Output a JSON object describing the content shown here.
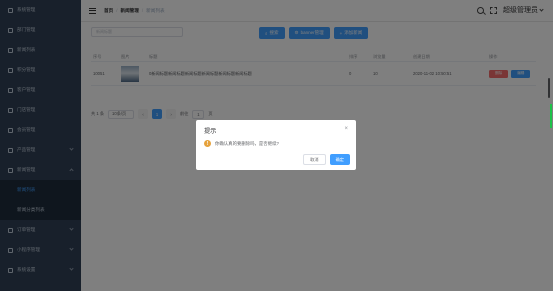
{
  "sidebar": {
    "items": [
      {
        "label": "系统管理",
        "chevron": false
      },
      {
        "label": "部门管理",
        "chevron": false
      },
      {
        "label": "新闻列表",
        "chevron": false
      },
      {
        "label": "积分管理",
        "chevron": false
      },
      {
        "label": "客户管理",
        "chevron": false
      },
      {
        "label": "门店管理",
        "chevron": false
      },
      {
        "label": "会员管理",
        "chevron": false
      },
      {
        "label": "产品管理",
        "chevron": true
      },
      {
        "label": "新闻管理",
        "chevron": true
      }
    ],
    "sub_items": [
      "新闻列表",
      "新闻分类列表"
    ],
    "bottom_items": [
      {
        "label": "订单管理",
        "chevron": true
      },
      {
        "label": "小程序管理",
        "chevron": true
      },
      {
        "label": "系统设置",
        "chevron": true
      }
    ]
  },
  "header": {
    "breadcrumb": [
      "首页",
      "新闻管理",
      "新闻列表"
    ],
    "user": "超级管理员"
  },
  "toolbar": {
    "search_placeholder": "新闻标题",
    "search_label": "搜索",
    "banner_label": "banner管理",
    "add_label": "添加新闻"
  },
  "table": {
    "headers": {
      "id": "序号",
      "img": "图片",
      "title": "标题",
      "sort": "排序",
      "views": "浏览量",
      "date": "创建日期",
      "actions": "操作"
    },
    "rows": [
      {
        "id": "10051",
        "title": "0新闻标题新闻标题新闻标题新闻标题新闻标题新闻标题",
        "sort": "0",
        "views": "10",
        "date": "2020-11-02 10:50:51",
        "delete": "删除",
        "edit": "编辑"
      }
    ]
  },
  "pager": {
    "total": "共 1 条",
    "page_size": "10条/页",
    "prev": "‹",
    "current": "1",
    "next": "›",
    "goto": "前往",
    "goto_value": "1",
    "page_suffix": "页"
  },
  "dialog": {
    "title": "提示",
    "message": "你确认真的要删除吗，是否继续?",
    "cancel": "取消",
    "confirm": "确定"
  }
}
